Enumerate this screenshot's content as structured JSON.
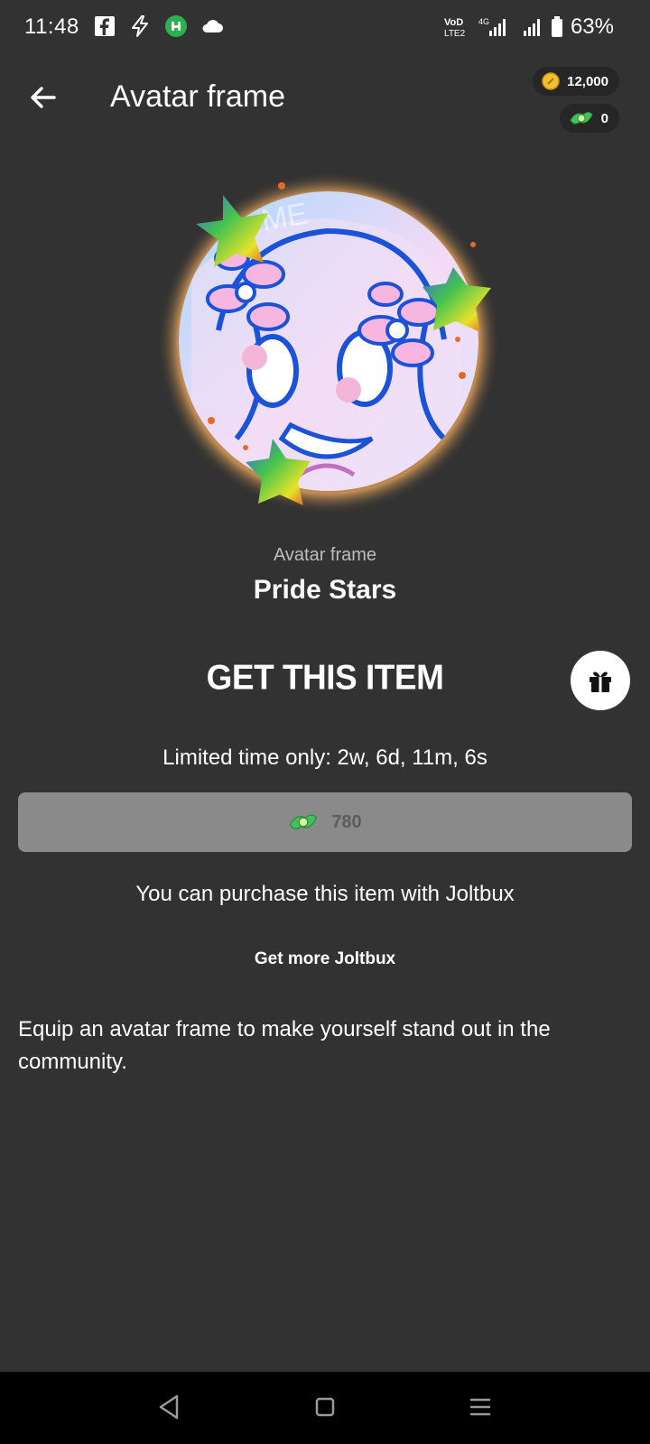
{
  "status_bar": {
    "time": "11:48",
    "battery": "63%",
    "left_icons": [
      "facebook-icon",
      "bolt-icon",
      "app-badge-icon",
      "cloud-icon"
    ],
    "right_icons": [
      "volte-icon",
      "signal-4g-icon",
      "signal-icon",
      "battery-icon"
    ]
  },
  "header": {
    "title": "Avatar frame",
    "coins": "12,000",
    "joltbux": "0"
  },
  "item": {
    "type_label": "Avatar frame",
    "name": "Pride Stars"
  },
  "get_item": {
    "title": "GET THIS ITEM",
    "limited_time": "Limited time only: 2w, 6d, 11m, 6s",
    "price": "780",
    "purchase_note": "You can purchase this item with Joltbux",
    "more_link": "Get more Joltbux"
  },
  "description": "Equip an avatar frame to make yourself stand out in the community.",
  "colors": {
    "background": "#323232",
    "button_disabled": "#8a8a8a",
    "joltbux_green": "#43c15a",
    "coin_gold": "#f2c12e"
  }
}
